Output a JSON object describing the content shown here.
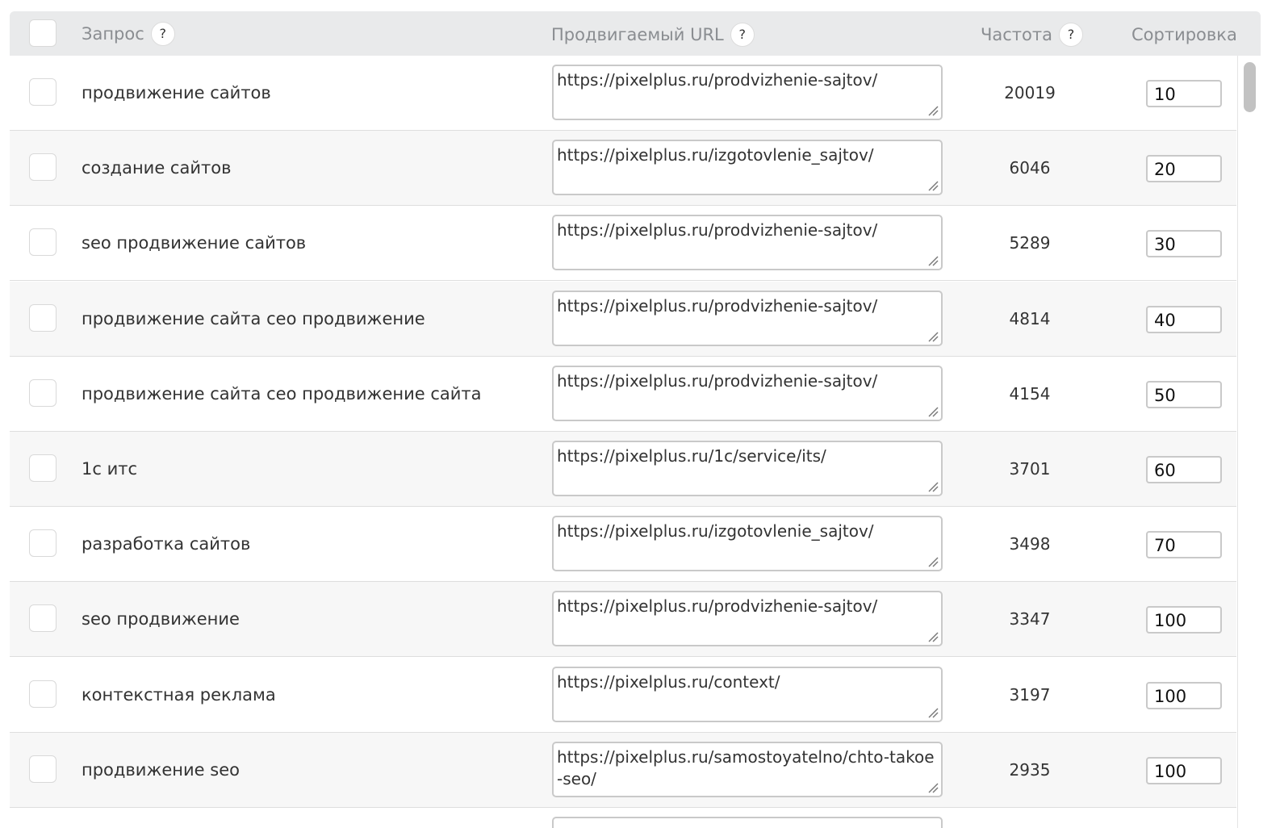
{
  "header": {
    "query_label": "Запрос",
    "url_label": "Продвигаемый URL",
    "freq_label": "Частота",
    "sort_label": "Сортировка",
    "help_symbol": "?"
  },
  "rows": [
    {
      "query": "продвижение сайтов",
      "url": "https://pixelplus.ru/prodvizhenie-sajtov/",
      "freq": "20019",
      "sort": "10"
    },
    {
      "query": "создание сайтов",
      "url": "https://pixelplus.ru/izgotovlenie_sajtov/",
      "freq": "6046",
      "sort": "20"
    },
    {
      "query": "seo продвижение сайтов",
      "url": "https://pixelplus.ru/prodvizhenie-sajtov/",
      "freq": "5289",
      "sort": "30"
    },
    {
      "query": "продвижение сайта сео продвижение",
      "url": "https://pixelplus.ru/prodvizhenie-sajtov/",
      "freq": "4814",
      "sort": "40"
    },
    {
      "query": "продвижение сайта сео продвижение сайта",
      "url": "https://pixelplus.ru/prodvizhenie-sajtov/",
      "freq": "4154",
      "sort": "50"
    },
    {
      "query": "1с итс",
      "url": "https://pixelplus.ru/1c/service/its/",
      "freq": "3701",
      "sort": "60"
    },
    {
      "query": "разработка сайтов",
      "url": "https://pixelplus.ru/izgotovlenie_sajtov/",
      "freq": "3498",
      "sort": "70"
    },
    {
      "query": "seo продвижение",
      "url": "https://pixelplus.ru/prodvizhenie-sajtov/",
      "freq": "3347",
      "sort": "100"
    },
    {
      "query": "контекстная реклама",
      "url": "https://pixelplus.ru/context/",
      "freq": "3197",
      "sort": "100"
    },
    {
      "query": "продвижение seo",
      "url": "https://pixelplus.ru/samostoyatelno/chto-takoe-seo/",
      "freq": "2935",
      "sort": "100"
    }
  ]
}
